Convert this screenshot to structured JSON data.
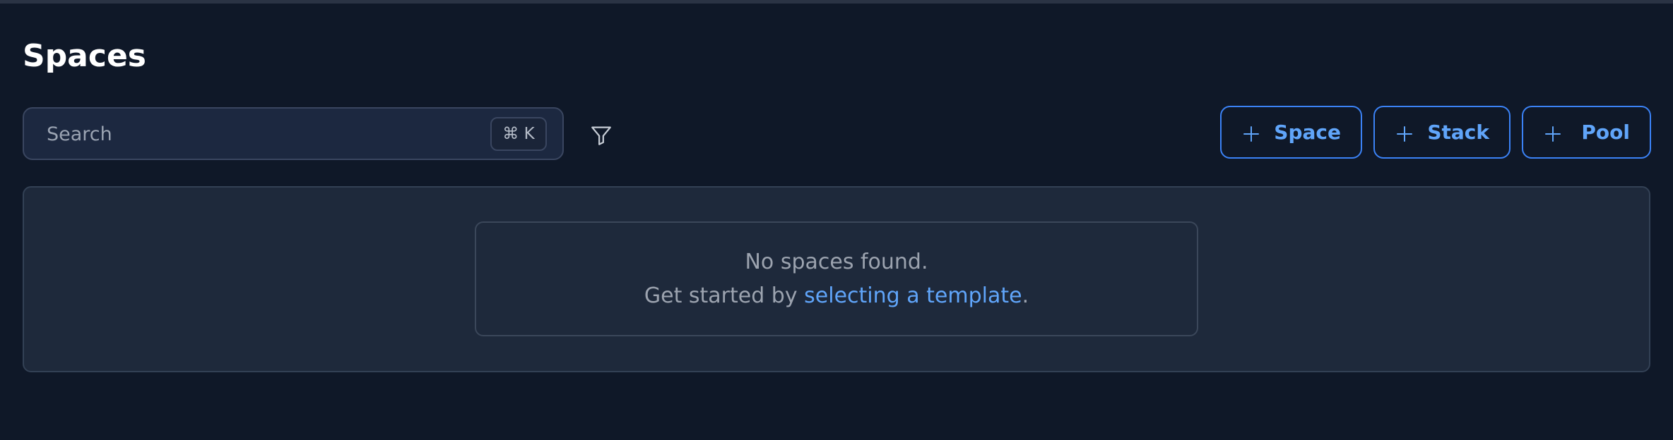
{
  "page": {
    "title": "Spaces"
  },
  "search": {
    "placeholder": "Search",
    "value": "",
    "shortcut": "⌘ K"
  },
  "icons": {
    "filter": "filter-icon",
    "plus": "plus-icon"
  },
  "actions": {
    "space_label": "Space",
    "stack_label": "Stack",
    "pool_label": "Pool"
  },
  "empty_state": {
    "message": "No spaces found.",
    "prompt_prefix": "Get started by",
    "link_text": "selecting a template",
    "prompt_suffix": "."
  },
  "colors": {
    "background": "#0f1828",
    "panel": "#1e293b",
    "accent": "#3b82f6",
    "link": "#60a5fa"
  }
}
